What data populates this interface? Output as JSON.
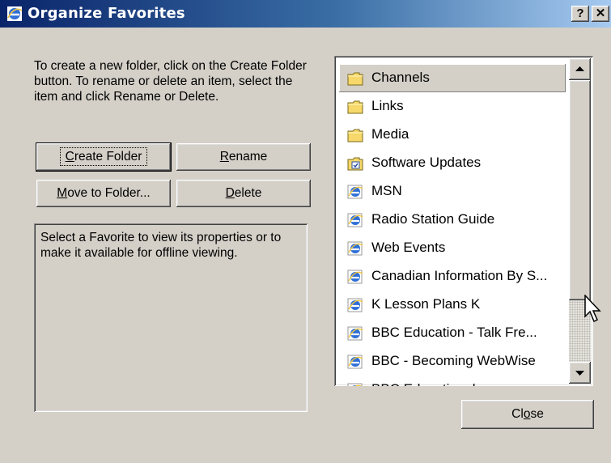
{
  "window": {
    "title": "Organize Favorites",
    "help_label": "?",
    "close_label": "✕"
  },
  "instructions": "To create a new folder, click on the Create Folder button. To rename or delete an item, select the item and click Rename or Delete.",
  "buttons": {
    "create_folder": {
      "pre": "",
      "key": "C",
      "post": "reate Folder"
    },
    "rename": {
      "pre": "",
      "key": "R",
      "post": "ename"
    },
    "move_to_folder": {
      "pre": "",
      "key": "M",
      "post": "ove to Folder..."
    },
    "delete": {
      "pre": "",
      "key": "D",
      "post": "elete"
    },
    "close": {
      "pre": "Cl",
      "key": "o",
      "post": "se"
    }
  },
  "properties_text": "Select a Favorite to view its properties or to make it available for offline viewing.",
  "favorites": [
    {
      "label": "Channels",
      "icon": "folder-icon",
      "selected": true
    },
    {
      "label": "Links",
      "icon": "folder-icon"
    },
    {
      "label": "Media",
      "icon": "folder-icon"
    },
    {
      "label": "Software Updates",
      "icon": "special-folder-icon"
    },
    {
      "label": "MSN",
      "icon": "ie-link-icon"
    },
    {
      "label": "Radio Station Guide",
      "icon": "ie-link-icon"
    },
    {
      "label": "Web Events",
      "icon": "ie-link-icon"
    },
    {
      "label": "Canadian Information By S...",
      "icon": "ie-link-icon"
    },
    {
      "label": "K Lesson Plans K",
      "icon": "ie-link-icon"
    },
    {
      "label": "BBC Education - Talk Fre...",
      "icon": "ie-link-icon"
    },
    {
      "label": "BBC - Becoming WebWise",
      "icon": "ie-link-icon"
    },
    {
      "label": "BBC Educational...",
      "icon": "ie-link-icon"
    }
  ],
  "colors": {
    "title_start": "#0a246a",
    "title_end": "#a6caf0",
    "face": "#d4d0c8",
    "folder": "#f7d86b"
  }
}
